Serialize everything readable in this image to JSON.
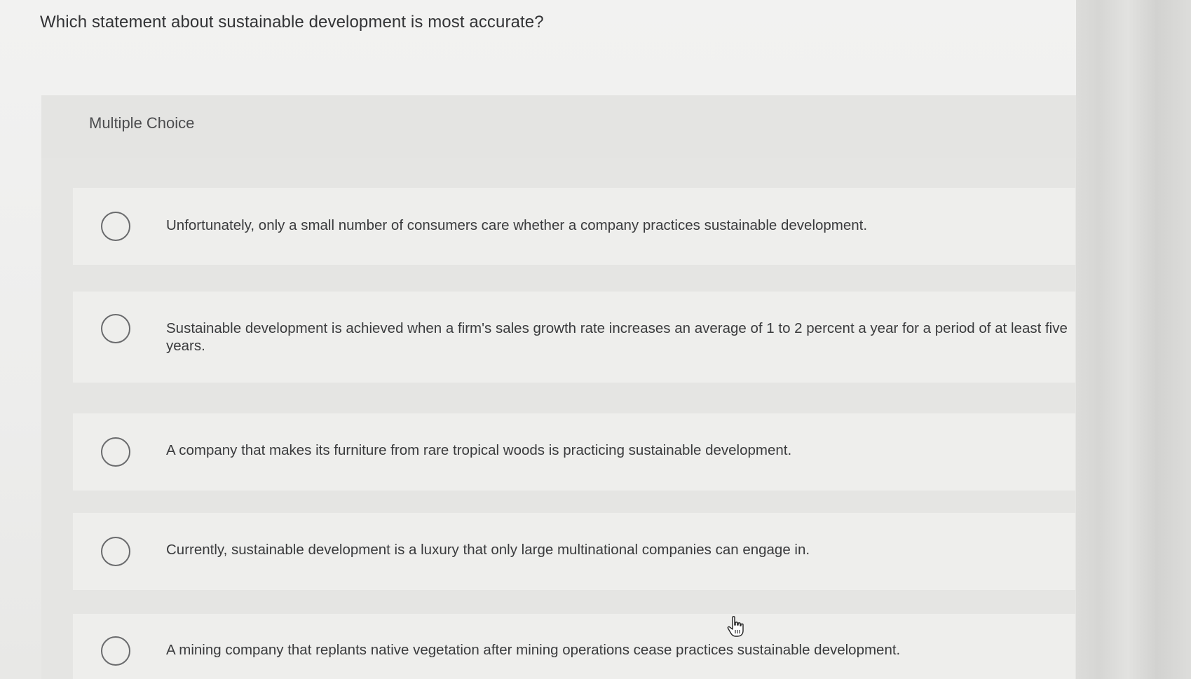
{
  "question": {
    "text": "Which statement about sustainable development is most accurate?"
  },
  "question_type": {
    "label": "Multiple Choice"
  },
  "options": [
    {
      "text": "Unfortunately, only a small number of consumers care whether a company practices sustainable development."
    },
    {
      "text": "Sustainable development is achieved when a firm's sales growth rate increases an average of 1 to 2 percent a year for a period of at least five years."
    },
    {
      "text": "A company that makes its furniture from rare tropical woods is practicing sustainable development."
    },
    {
      "text": "Currently, sustainable development is a luxury that only large multinational companies can engage in."
    },
    {
      "text": "A mining company that replants native vegetation after mining operations cease practices sustainable development."
    }
  ],
  "colors": {
    "text": "#3a3b3d",
    "radio_border": "#6a6b6d",
    "header_band": "#e4e4e2",
    "option_bg": "#eeeeec"
  },
  "icons": {
    "radio": "radio-unchecked-icon",
    "cursor": "hand-pointer-icon"
  }
}
